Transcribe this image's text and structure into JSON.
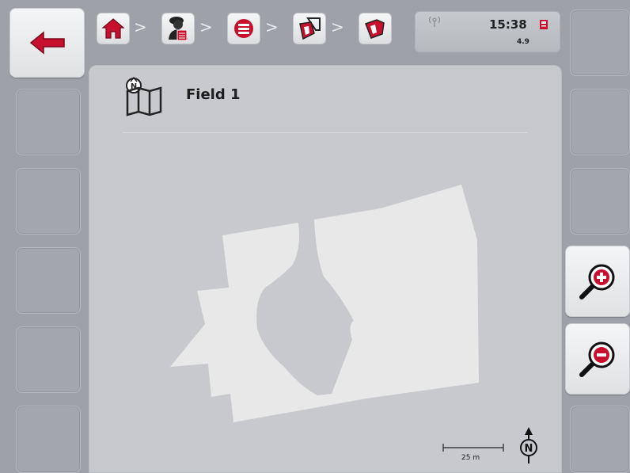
{
  "status": {
    "time": "15:38",
    "version": "4.9"
  },
  "field": {
    "title": "Field 1"
  },
  "map": {
    "scale_label": "25 m"
  },
  "colors": {
    "field_fill": "#e8e8e8",
    "accent_red": "#c8102e"
  },
  "breadcrumb_icons": [
    "home-icon",
    "operator-icon",
    "list-icon",
    "fields-icon",
    "field-icon"
  ],
  "softkeys": {
    "left": [
      "back-icon",
      "",
      "",
      "",
      "",
      ""
    ],
    "right": [
      "",
      "",
      "",
      "zoom-in-icon",
      "zoom-out-icon",
      ""
    ]
  }
}
